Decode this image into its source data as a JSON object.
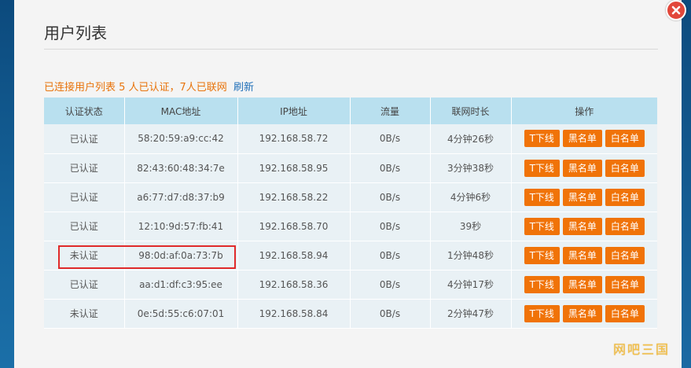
{
  "dialog": {
    "title": "用户列表",
    "summary": "已连接用户列表 5 人已认证，7人已联网",
    "refresh_label": "刷新"
  },
  "table": {
    "headers": [
      "认证状态",
      "MAC地址",
      "IP地址",
      "流量",
      "联网时长",
      "操作"
    ],
    "actions": {
      "kick": "T下线",
      "blacklist": "黑名单",
      "whitelist": "白名单"
    },
    "rows": [
      {
        "status": "已认证",
        "mac": "58:20:59:a9:cc:42",
        "ip": "192.168.58.72",
        "traffic": "0B/s",
        "duration": "4分钟26秒"
      },
      {
        "status": "已认证",
        "mac": "82:43:60:48:34:7e",
        "ip": "192.168.58.95",
        "traffic": "0B/s",
        "duration": "3分钟38秒"
      },
      {
        "status": "已认证",
        "mac": "a6:77:d7:d8:37:b9",
        "ip": "192.168.58.22",
        "traffic": "0B/s",
        "duration": "4分钟6秒"
      },
      {
        "status": "已认证",
        "mac": "12:10:9d:57:fb:41",
        "ip": "192.168.58.70",
        "traffic": "0B/s",
        "duration": "39秒"
      },
      {
        "status": "未认证",
        "mac": "98:0d:af:0a:73:7b",
        "ip": "192.168.58.94",
        "traffic": "0B/s",
        "duration": "1分钟48秒"
      },
      {
        "status": "已认证",
        "mac": "aa:d1:df:c3:95:ee",
        "ip": "192.168.58.36",
        "traffic": "0B/s",
        "duration": "4分钟17秒"
      },
      {
        "status": "未认证",
        "mac": "0e:5d:55:c6:07:01",
        "ip": "192.168.58.84",
        "traffic": "0B/s",
        "duration": "2分钟47秒"
      }
    ]
  },
  "watermark": "网吧三国",
  "colors": {
    "accent": "#f07308",
    "header_bg": "#b9e0ef",
    "highlight": "#e02a2a",
    "close": "#e2473a"
  }
}
